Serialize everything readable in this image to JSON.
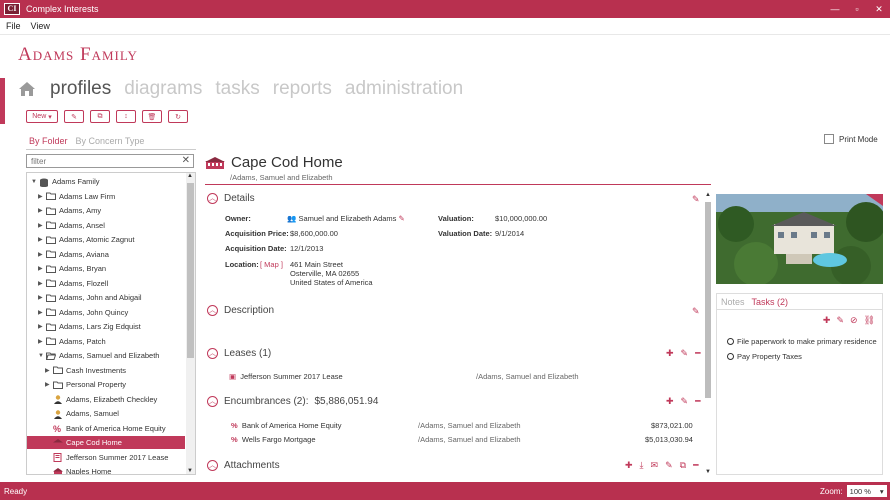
{
  "app": {
    "logo_text": "CI",
    "title": "Complex Interests",
    "window_controls": [
      "—",
      "▫",
      "✕"
    ]
  },
  "menu": [
    "File",
    "View"
  ],
  "family_name": "Adams Family",
  "nav": {
    "items": [
      "profiles",
      "diagrams",
      "tasks",
      "reports",
      "administration"
    ],
    "active": "profiles"
  },
  "toolbar": {
    "new_label": "New",
    "buttons": [
      "pencil-icon",
      "copy-icon",
      "move-icon",
      "trash-icon",
      "refresh-icon"
    ]
  },
  "folder_tabs": [
    "By Folder",
    "By Concern Type"
  ],
  "filter": {
    "placeholder": "filter",
    "value": ""
  },
  "tree": [
    {
      "label": "Adams Family",
      "level": 0,
      "icon": "database-icon",
      "toggle": "▼"
    },
    {
      "label": "Adams Law Firm",
      "level": 1,
      "icon": "folder-icon",
      "toggle": "▶"
    },
    {
      "label": "Adams, Amy",
      "level": 1,
      "icon": "folder-icon",
      "toggle": "▶"
    },
    {
      "label": "Adams, Ansel",
      "level": 1,
      "icon": "folder-icon",
      "toggle": "▶"
    },
    {
      "label": "Adams, Atomic Zagnut",
      "level": 1,
      "icon": "folder-icon",
      "toggle": "▶"
    },
    {
      "label": "Adams, Aviana",
      "level": 1,
      "icon": "folder-icon",
      "toggle": "▶"
    },
    {
      "label": "Adams, Bryan",
      "level": 1,
      "icon": "folder-icon",
      "toggle": "▶"
    },
    {
      "label": "Adams, Flozell",
      "level": 1,
      "icon": "folder-icon",
      "toggle": "▶"
    },
    {
      "label": "Adams, John and Abigail",
      "level": 1,
      "icon": "folder-icon",
      "toggle": "▶"
    },
    {
      "label": "Adams, John Quincy",
      "level": 1,
      "icon": "folder-icon",
      "toggle": "▶"
    },
    {
      "label": "Adams, Lars Zig Edquist",
      "level": 1,
      "icon": "folder-icon",
      "toggle": "▶"
    },
    {
      "label": "Adams, Patch",
      "level": 1,
      "icon": "folder-icon",
      "toggle": "▶"
    },
    {
      "label": "Adams, Samuel and Elizabeth",
      "level": 1,
      "icon": "folder-open-icon",
      "toggle": "▼"
    },
    {
      "label": "Cash Investments",
      "level": 2,
      "icon": "folder-icon",
      "toggle": "▶"
    },
    {
      "label": "Personal Property",
      "level": 2,
      "icon": "folder-icon",
      "toggle": "▶"
    },
    {
      "label": "Adams, Elizabeth Checkley",
      "level": 2,
      "icon": "person-icon",
      "toggle": ""
    },
    {
      "label": "Adams, Samuel",
      "level": 2,
      "icon": "person-icon",
      "toggle": ""
    },
    {
      "label": "Bank of America Home Equity",
      "level": 2,
      "icon": "percent-icon",
      "toggle": ""
    },
    {
      "label": "Cape Cod Home",
      "level": 2,
      "icon": "house-icon",
      "toggle": "",
      "selected": true
    },
    {
      "label": "Jefferson Summer 2017 Lease",
      "level": 2,
      "icon": "lease-icon",
      "toggle": ""
    },
    {
      "label": "Naples Home",
      "level": 2,
      "icon": "house-icon",
      "toggle": ""
    }
  ],
  "print_mode_label": "Print Mode",
  "property": {
    "title": "Cape Cod Home",
    "path": "/Adams, Samuel and Elizabeth"
  },
  "details": {
    "heading": "Details",
    "owner_label": "Owner:",
    "owner_value": "Samuel and Elizabeth Adams",
    "valuation_label": "Valuation:",
    "valuation_value": "$10,000,000.00",
    "acq_price_label": "Acquisition Price:",
    "acq_price_value": "$8,600,000.00",
    "valuation_date_label": "Valuation Date:",
    "valuation_date_value": "9/1/2014",
    "acq_date_label": "Acquisition Date:",
    "acq_date_value": "12/1/2013",
    "location_label": "Location:",
    "map_link": "[ Map ]",
    "address_1": "461 Main Street",
    "address_2": "Osterville, MA 02655",
    "address_3": "United States of America"
  },
  "description": {
    "heading": "Description"
  },
  "leases": {
    "heading": "Leases (1)",
    "items": [
      {
        "name": "Jefferson Summer 2017 Lease",
        "path": "/Adams, Samuel and Elizabeth"
      }
    ]
  },
  "encumbrances": {
    "heading": "Encumbrances (2):",
    "total": "$5,886,051.94",
    "items": [
      {
        "name": "Bank of America Home Equity",
        "path": "/Adams, Samuel and Elizabeth",
        "amount": "$873,021.00"
      },
      {
        "name": "Wells Fargo Mortgage",
        "path": "/Adams, Samuel and Elizabeth",
        "amount": "$5,013,030.94"
      }
    ]
  },
  "attachments": {
    "heading": "Attachments"
  },
  "side": {
    "tabs": [
      "Notes",
      "Tasks (2)"
    ],
    "active_tab": "Tasks (2)",
    "tasks": [
      "File paperwork to make primary residence",
      "Pay Property Taxes"
    ]
  },
  "status": {
    "text": "Ready",
    "zoom_label": "Zoom:",
    "zoom_value": "100 %"
  },
  "colors": {
    "accent": "#c0395a",
    "titlebar": "#b8304f"
  }
}
